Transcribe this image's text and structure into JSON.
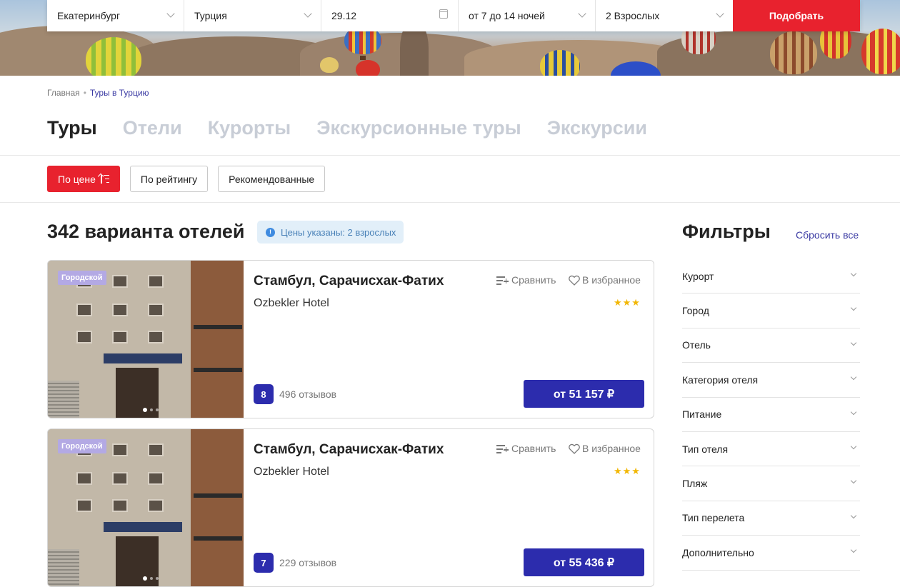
{
  "search": {
    "city": "Екатеринбург",
    "country": "Турция",
    "date": "29.12",
    "nights": "от 7 до 14 ночей",
    "guests": "2 Взрослых",
    "submit_label": "Подобрать"
  },
  "breadcrumb": {
    "home": "Главная",
    "separator": "•",
    "current": "Туры в Турцию"
  },
  "tabs": [
    "Туры",
    "Отели",
    "Курорты",
    "Экскурсионные туры",
    "Экскурсии"
  ],
  "sort": {
    "price": "По цене",
    "rating": "По рейтингу",
    "recommended": "Рекомендованные"
  },
  "results": {
    "count_title": "342 варианта отелей",
    "price_note": "Цены указаны: 2 взрослых"
  },
  "cards": [
    {
      "badge": "Городской",
      "title": "Стамбул, Сарачисхак-Фатих",
      "hotel": "Ozbekler Hotel",
      "compare_label": "Сравнить",
      "favorite_label": "В избранное",
      "stars": "★★★",
      "rating": "8",
      "reviews": "496 отзывов",
      "price": "от 51 157 ₽"
    },
    {
      "badge": "Городской",
      "title": "Стамбул, Сарачисхак-Фатих",
      "hotel": "Ozbekler Hotel",
      "compare_label": "Сравнить",
      "favorite_label": "В избранное",
      "stars": "★★★",
      "rating": "7",
      "reviews": "229 отзывов",
      "price": "от 55 436 ₽"
    }
  ],
  "filters": {
    "title": "Фильтры",
    "reset_label": "Сбросить все",
    "items": [
      "Курорт",
      "Город",
      "Отель",
      "Категория отеля",
      "Питание",
      "Тип отеля",
      "Пляж",
      "Тип перелета",
      "Дополнительно"
    ]
  },
  "colors": {
    "accent_red": "#e8222e",
    "accent_blue": "#2c2cad",
    "link": "#3a3aa3",
    "badge_purple": "#b3a9e4",
    "star_yellow": "#f2b705"
  },
  "icons": {
    "dropdown": "chevron-down-icon",
    "calendar": "calendar-icon",
    "sort": "sort-ascending-icon",
    "info": "info-icon",
    "compare": "compare-list-icon",
    "favorite": "heart-icon"
  }
}
